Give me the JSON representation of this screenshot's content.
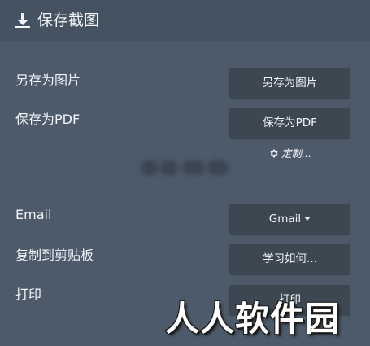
{
  "header": {
    "title": "保存截图",
    "icon": "download-icon"
  },
  "rows": [
    {
      "label": "另存为图片",
      "button": "另存为图片"
    },
    {
      "label": "保存为PDF",
      "button": "保存为PDF"
    },
    {
      "label": "Email",
      "button": "Gmail"
    },
    {
      "label": "复制到剪贴板",
      "button": "学习如何..."
    },
    {
      "label": "打印",
      "button": "打印"
    }
  ],
  "customize": {
    "label": "定制...",
    "icon": "gear-icon"
  },
  "watermark": {
    "text": "人人软件园"
  },
  "colors": {
    "panel_bg": "#4c5a6a",
    "header_bg": "#455261",
    "button_bg": "#3d4752",
    "text": "#f3f5f8"
  }
}
